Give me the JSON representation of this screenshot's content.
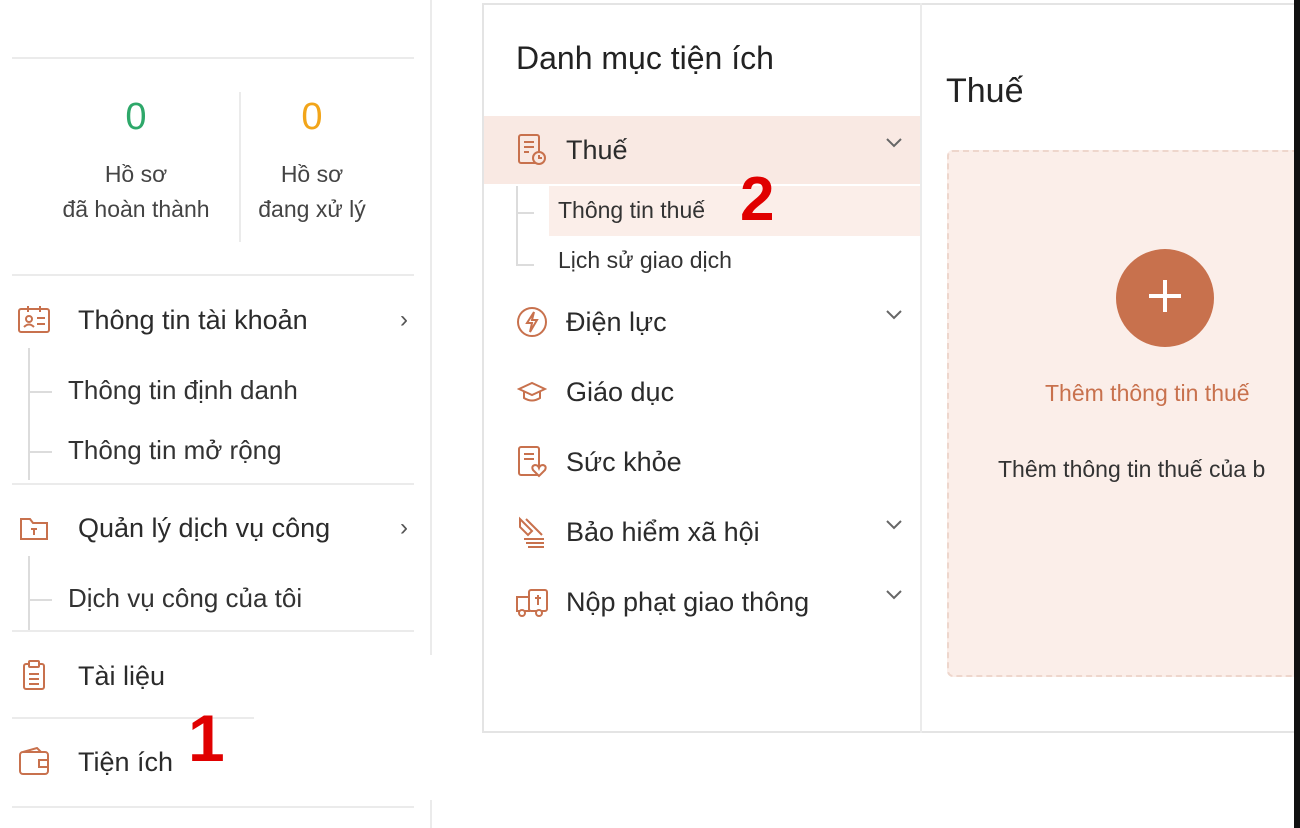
{
  "stats": [
    {
      "value": "0",
      "label_line1": "Hồ sơ",
      "label_line2": "đã hoàn thành",
      "color": "#2ea86a"
    },
    {
      "value": "0",
      "label_line1": "Hồ sơ",
      "label_line2": "đang xử lý",
      "color": "#f2a51a"
    }
  ],
  "sidebar": {
    "account": {
      "label": "Thông tin tài khoản",
      "icon": "id-card-icon",
      "children": [
        "Thông tin định danh",
        "Thông tin mở rộng"
      ]
    },
    "services": {
      "label": "Quản lý dịch vụ công",
      "icon": "folder-icon",
      "children": [
        "Dịch vụ công của tôi"
      ]
    },
    "documents": {
      "label": "Tài liệu",
      "icon": "document-icon"
    },
    "utilities": {
      "label": "Tiện ích",
      "icon": "wallet-icon"
    }
  },
  "catalog": {
    "title": "Danh mục tiện ích",
    "items": [
      {
        "label": "Thuế",
        "icon": "tax-document-icon",
        "expanded": true,
        "children": [
          "Thông tin thuế",
          "Lịch sử giao dịch"
        ]
      },
      {
        "label": "Điện lực",
        "icon": "lightning-icon"
      },
      {
        "label": "Giáo dục",
        "icon": "graduation-cap-icon"
      },
      {
        "label": "Sức khỏe",
        "icon": "health-record-icon"
      },
      {
        "label": "Bảo hiểm xã hội",
        "icon": "insurance-icon"
      },
      {
        "label": "Nộp phạt giao thông",
        "icon": "traffic-fine-icon"
      }
    ]
  },
  "content": {
    "title": "Thuế",
    "add_label": "Thêm thông tin thuế",
    "description": "Thêm thông tin thuế của b"
  },
  "annotations": [
    "1",
    "2"
  ],
  "colors": {
    "accent": "#c8714d",
    "accent_light": "#fbeee9",
    "selected_bg": "#f9e9e3"
  }
}
